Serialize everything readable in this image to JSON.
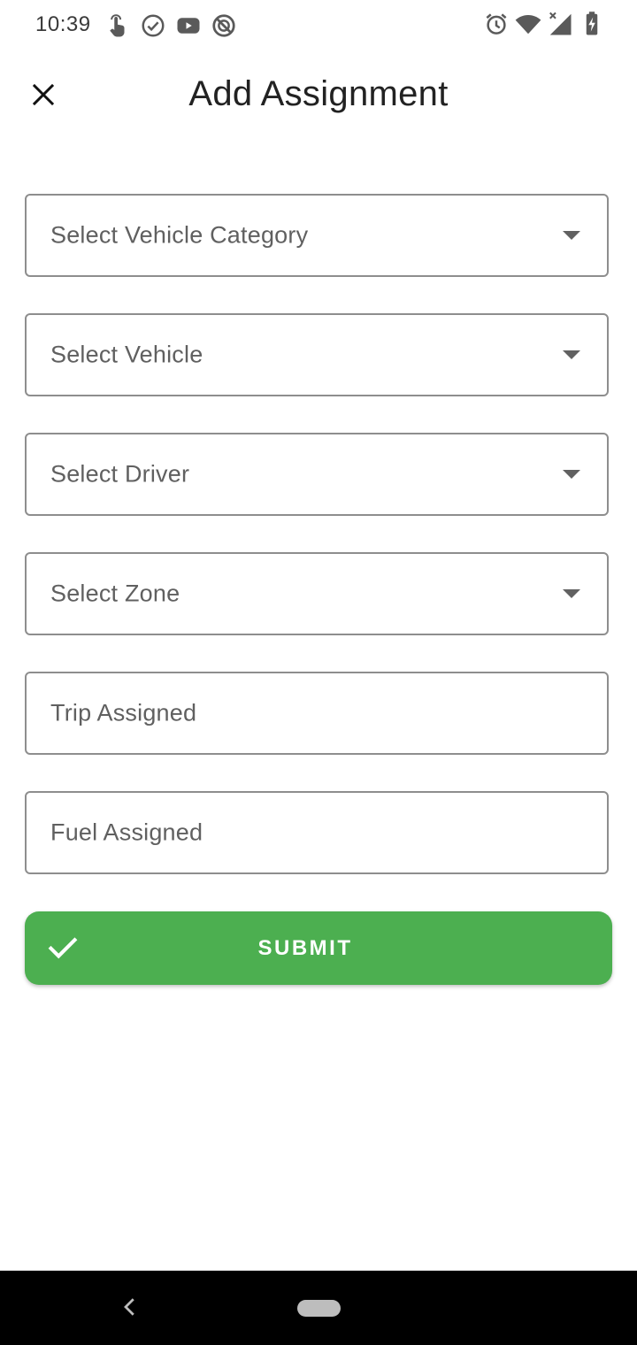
{
  "status_bar": {
    "time": "10:39",
    "left_icons": [
      "touch-icon",
      "check-circle-icon",
      "youtube-icon",
      "do-not-disturb-icon"
    ],
    "right_icons": [
      "alarm-icon",
      "wifi-icon",
      "signal-icon",
      "battery-charging-icon"
    ]
  },
  "app_bar": {
    "title": "Add Assignment",
    "close_icon": "close-icon"
  },
  "form": {
    "vehicle_category_placeholder": "Select Vehicle Category",
    "vehicle_placeholder": "Select Vehicle",
    "driver_placeholder": "Select Driver",
    "zone_placeholder": "Select Zone",
    "trip_assigned_placeholder": "Trip Assigned",
    "fuel_assigned_placeholder": "Fuel Assigned",
    "dropdown_icon": "dropdown-arrow-icon"
  },
  "submit": {
    "label": "SUBMIT",
    "icon": "check-icon",
    "color": "#4caf50"
  },
  "nav_bar": {
    "back_icon": "back-chevron-icon",
    "home_icon": "home-pill-icon"
  }
}
